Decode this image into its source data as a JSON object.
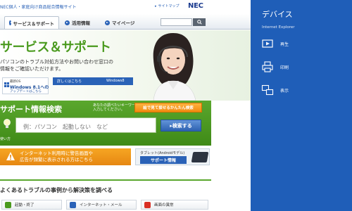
{
  "site": {
    "name": "NEC個人・家庭向け商品総合情報サイト",
    "sitemap": "サイトマップ",
    "logo": "NEC"
  },
  "nav": {
    "tabs": [
      {
        "label": "サービス＆サポート",
        "active": true
      },
      {
        "label": "活用情報",
        "active": false
      },
      {
        "label": "マイページ",
        "active": false
      }
    ]
  },
  "hero": {
    "title": "サービス＆サポート",
    "text_line1": "パソコンのトラブル対処方法やお問い合わせ窓口の",
    "text_line2": "情報をご確認いただけます。",
    "win_banner": {
      "line1": "最新OS",
      "line2": "Windows 8.1への",
      "line3": "アップデートはこちら"
    },
    "win8_strip": {
      "label": "詳しくはこちら",
      "badge": "Windows8"
    }
  },
  "search": {
    "title": "サポート情報検索",
    "hint_line1": "あなたの調べたいキーワードを",
    "hint_line2": "入力してください。",
    "visual_button": "絵で見て探せるかんたん検索",
    "placeholder": "例：パソコン　起動しない　など",
    "button": "▸検索する",
    "usage_link": "使い方"
  },
  "banners": {
    "warning_line1": "インターネット利用時に警告画面や",
    "warning_line2": "広告が頻繁に表示される方はこちら",
    "tablet_small": "タブレット(Androidモデル)",
    "tablet_big": "サポート情報"
  },
  "troubles": {
    "title": "よくあるトラブルの事例から解決策を調べる",
    "items": [
      {
        "label": "起動・終了"
      },
      {
        "label": "インターネット・メール"
      },
      {
        "label": "画面の異常"
      }
    ]
  },
  "charm": {
    "title": "デバイス",
    "app": "Internet Explorer",
    "items": [
      {
        "label": "再生",
        "icon": "play-to-icon"
      },
      {
        "label": "印刷",
        "icon": "printer-icon"
      },
      {
        "label": "表示",
        "icon": "project-icon"
      }
    ],
    "background": "#1f5eb8"
  },
  "colors": {
    "green": "#4a9a1e",
    "blue": "#2a62b7",
    "orange": "#f28a10"
  }
}
